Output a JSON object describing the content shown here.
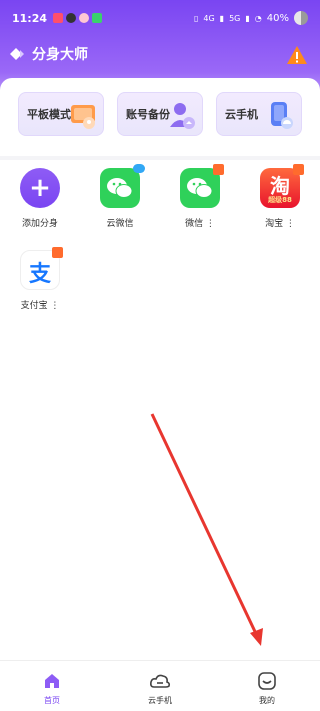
{
  "status_bar": {
    "time": "11:24",
    "network_left": "4G",
    "network_right": "5G",
    "battery": "40%"
  },
  "header": {
    "title": "分身大师"
  },
  "quick_cards": [
    {
      "label": "平板模式"
    },
    {
      "label": "账号备份"
    },
    {
      "label": "云手机"
    }
  ],
  "apps": [
    {
      "label": "添加分身",
      "icon": "plus-icon"
    },
    {
      "label": "云微信",
      "icon": "wechat-icon",
      "badge": "cloud"
    },
    {
      "label": "微信 ⋮",
      "icon": "wechat-icon",
      "badge": "orange"
    },
    {
      "label": "淘宝 ⋮",
      "icon": "taobao-icon",
      "badge": "orange",
      "icon_text": "淘",
      "icon_sub": "超级88"
    },
    {
      "label": "支付宝 ⋮",
      "icon": "alipay-icon",
      "badge": "orange",
      "icon_text": "支"
    }
  ],
  "tabs": [
    {
      "label": "首页",
      "active": true
    },
    {
      "label": "云手机",
      "active": false
    },
    {
      "label": "我的",
      "active": false
    }
  ],
  "colors": {
    "brand": "#7a45f2",
    "annotation_arrow": "#e8362f"
  }
}
